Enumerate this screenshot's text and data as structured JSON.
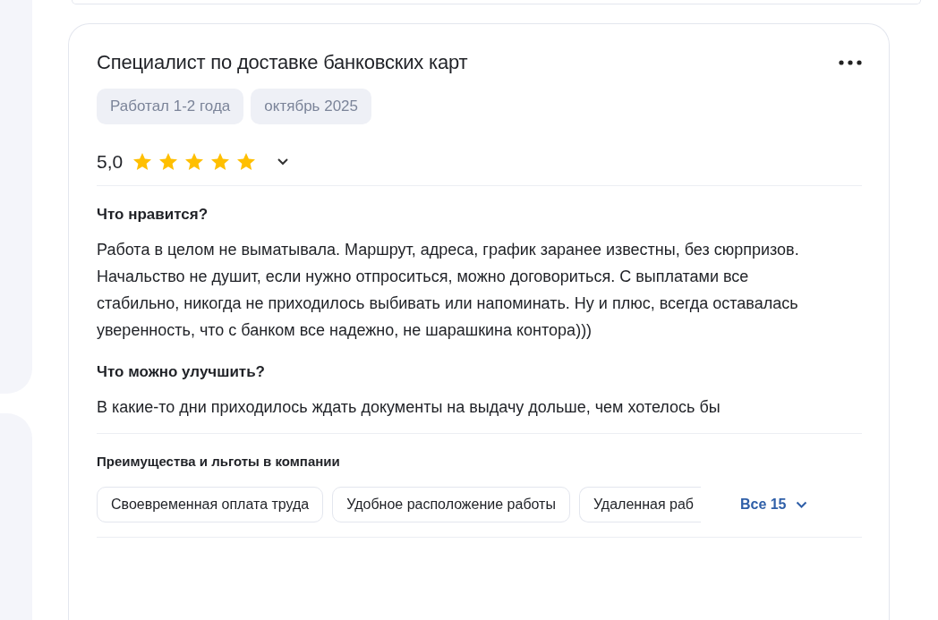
{
  "review": {
    "title": "Специалист по доставке банковских карт",
    "tags": [
      "Работал 1-2 года",
      "октябрь 2025"
    ],
    "rating": "5,0",
    "stars": 5,
    "sections": [
      {
        "heading": "Что нравится?",
        "text": "Работа в целом не выматывала. Маршрут, адреса, график заранее известны, без сюрпризов. Начальство не душит, если нужно отпроситься, можно договориться. С выплатами все стабильно, никогда не приходилось выбивать или напоминать. Ну и плюс, всегда оставалась уверенность, что с банком все надежно, не шарашкина контора)))"
      },
      {
        "heading": "Что можно улучшить?",
        "text": "В какие-то дни приходилось ждать документы на выдачу дольше, чем хотелось бы"
      }
    ],
    "benefits": {
      "heading": "Преимущества и льготы в компании",
      "items": [
        "Своевременная оплата труда",
        "Удобное расположение работы",
        "Удаленная раб"
      ],
      "more": "Все 15"
    }
  }
}
